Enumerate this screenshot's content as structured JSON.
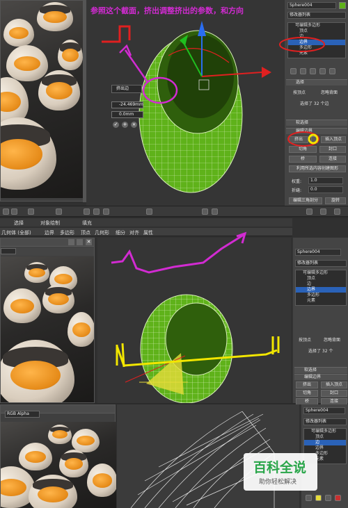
{
  "annotation": {
    "caption": "参照这个截面，挤出调整挤出的参数，和方向"
  },
  "top": {
    "panel": {
      "object_name": "Sphere004",
      "modifier_list_label": "修改器列表",
      "stack": [
        "可编辑多边形",
        "顶点",
        "边",
        "边界",
        "多边形",
        "元素"
      ],
      "selected_index": 3,
      "selection_label": "选择",
      "by_vertex": "按顶点",
      "ignore_backfacing": "忽略背面",
      "shrink": "收缩",
      "grow": "扩大",
      "ring": "环形",
      "loop": "循环",
      "selected_count": "选择了 32 个边",
      "soft_selection": "软选择",
      "edit_borders": "编辑边界",
      "extrude": "挤出",
      "insert_vertex": "插入顶点",
      "chamfer": "切角",
      "cap": "封口",
      "bridge": "桥",
      "connect": "连接",
      "create_shape": "利用所选内容创建图形",
      "weight_label": "权重:",
      "weight_value": "1.0",
      "crease_label": "折缝:",
      "crease_value": "0.0",
      "edit_tris": "编辑三角剖分",
      "rotate": "旋转"
    },
    "caddy": {
      "title": "挤出边",
      "height_value": "-24.469mm",
      "width_value": "0.0mm"
    }
  },
  "middle": {
    "menu": [
      "选择",
      "对象绘制",
      "填充"
    ],
    "ribbon_tabs": [
      "几何体 (全部)",
      "边界",
      "多边形",
      "顶点",
      "几何形",
      "细分",
      "对齐",
      "属性"
    ],
    "left_window_title": "",
    "panel": {
      "object_name": "Sphere004",
      "modifier_list_label": "修改器列表",
      "stack": [
        "可编辑多边形",
        "顶点",
        "边",
        "边界",
        "多边形",
        "元素"
      ],
      "selected_index": 3,
      "by_vertex": "按顶点",
      "ignore_backfacing": "忽略背面",
      "selected_count": "选择了 32 个",
      "soft_selection": "软选择",
      "edit_borders": "编辑边界",
      "extrude": "挤出",
      "insert_vertex": "插入顶点",
      "chamfer": "切角",
      "cap": "封口",
      "bridge": "桥",
      "connect": "连接"
    }
  },
  "bottom": {
    "channel_select": "RGB Alpha",
    "panel": {
      "object_name": "Sphere004",
      "modifier_list_label": "修改器列表",
      "stack": [
        "可编辑多边形",
        "顶点",
        "边",
        "边界",
        "多边形",
        "元素"
      ],
      "selected_index": 2
    }
  },
  "watermark": {
    "title": "百科全说",
    "subtitle": "助你轻松解决"
  },
  "colors": {
    "mesh_green": "#5fb21a",
    "annotation_magenta": "#d22bd2",
    "annotation_red": "#e02020",
    "annotation_yellow": "#f2e600",
    "selection_blue": "#2a62b8"
  }
}
